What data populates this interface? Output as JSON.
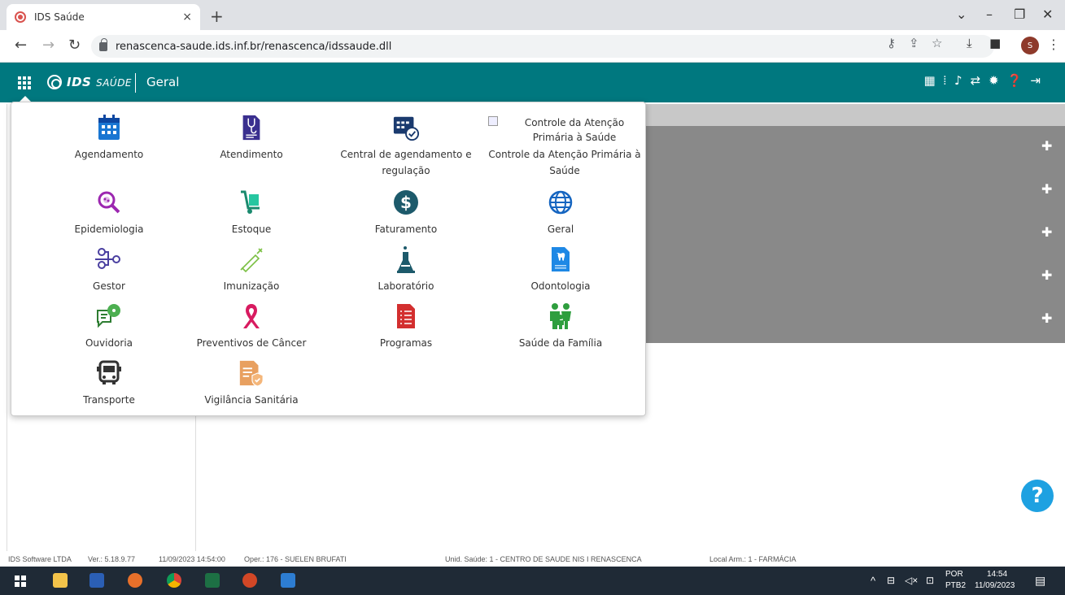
{
  "browser": {
    "tab_title": "IDS Saúde",
    "tab_close": "×",
    "new_tab": "+",
    "url": "renascenca-saude.ids.inf.br/renascenca/idssaude.dll",
    "profile_initial": "S"
  },
  "app": {
    "logo_main": "IDS",
    "logo_sub": "SAÚDE",
    "module": "Geral",
    "brand_color": "#00787f"
  },
  "menu": {
    "items": [
      {
        "label": "Agendamento"
      },
      {
        "label": "Atendimento"
      },
      {
        "label": "Central de agendamento e regulação"
      },
      {
        "label": "Controle da Atenção Primária à Saúde",
        "broken_image_alt": "Controle da Atenção Primária à Saúde"
      },
      {
        "label": "Epidemiologia"
      },
      {
        "label": "Estoque"
      },
      {
        "label": "Faturamento"
      },
      {
        "label": "Geral"
      },
      {
        "label": "Gestor"
      },
      {
        "label": "Imunização"
      },
      {
        "label": "Laboratório"
      },
      {
        "label": "Odontologia"
      },
      {
        "label": "Ouvidoria"
      },
      {
        "label": "Preventivos de Câncer"
      },
      {
        "label": "Programas"
      },
      {
        "label": "Saúde da Família"
      },
      {
        "label": "Transporte"
      },
      {
        "label": "Vigilância Sanitária"
      }
    ]
  },
  "status": {
    "company": "IDS Software LTDA",
    "version": "Ver.: 5.18.9.77",
    "datetime": "11/09/2023 14:54:00",
    "operator": "Oper.: 176 - SUELEN BRUFATI",
    "unit": "Unid. Saúde: 1 - CENTRO DE SAUDE NIS I RENASCENCA",
    "storage": "Local Arm.: 1 - FARMÁCIA"
  },
  "taskbar": {
    "lang": "POR",
    "layout": "PTB2",
    "time": "14:54",
    "date": "11/09/2023"
  }
}
